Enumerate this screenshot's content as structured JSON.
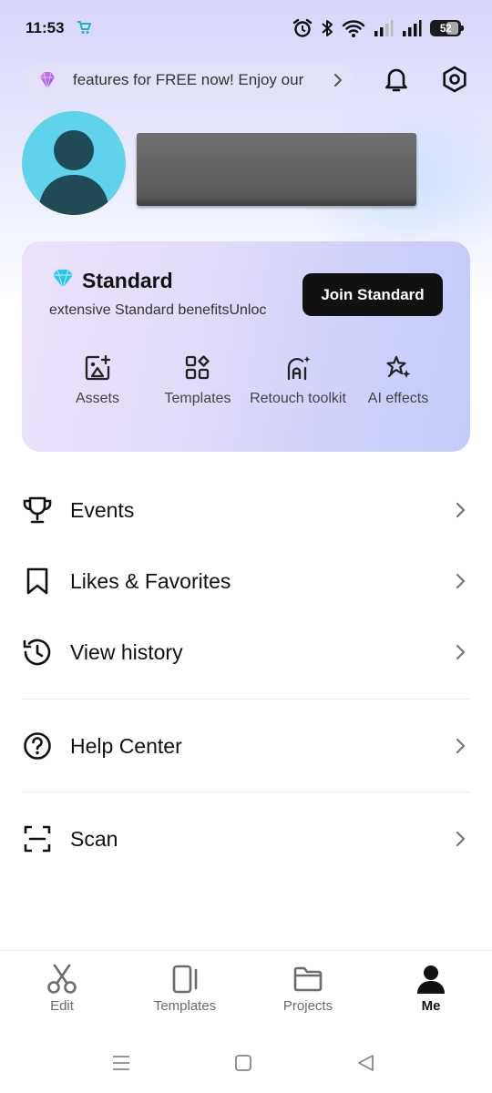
{
  "status_bar": {
    "time": "11:53",
    "battery": "52",
    "icons": [
      "app-cart-icon",
      "alarm-icon",
      "bluetooth-icon",
      "wifi-icon",
      "signal-icon",
      "signal-icon",
      "battery-icon"
    ]
  },
  "promo": {
    "text": "features for FREE now!  Enjoy our",
    "icon": "gem-icon"
  },
  "header_actions": [
    "bell-icon",
    "settings-icon"
  ],
  "membership": {
    "plan_name": "Standard",
    "benefits_text": "extensive Standard benefitsUnloc",
    "join_label": "Join Standard",
    "features": [
      {
        "label": "Assets",
        "icon": "assets-icon"
      },
      {
        "label": "Templates",
        "icon": "templates-icon"
      },
      {
        "label": "Retouch toolkit",
        "icon": "retouch-icon"
      },
      {
        "label": "AI effects",
        "icon": "ai-effects-icon"
      }
    ]
  },
  "menu": [
    {
      "label": "Events",
      "icon": "trophy-icon"
    },
    {
      "label": "Likes & Favorites",
      "icon": "bookmark-icon"
    },
    {
      "label": "View history",
      "icon": "history-icon"
    },
    {
      "label": "Help Center",
      "icon": "help-icon"
    },
    {
      "label": "Scan",
      "icon": "scan-icon"
    }
  ],
  "bottom_nav": [
    {
      "label": "Edit",
      "icon": "scissors-icon",
      "active": false
    },
    {
      "label": "Templates",
      "icon": "template-phone-icon",
      "active": false
    },
    {
      "label": "Projects",
      "icon": "folder-icon",
      "active": false
    },
    {
      "label": "Me",
      "icon": "person-icon",
      "active": true
    }
  ],
  "colors": {
    "accent_dark": "#111111",
    "avatar_bg": "#5fd2ec",
    "gem": "#2cc7e8",
    "promo_gem": "#b86be8"
  }
}
